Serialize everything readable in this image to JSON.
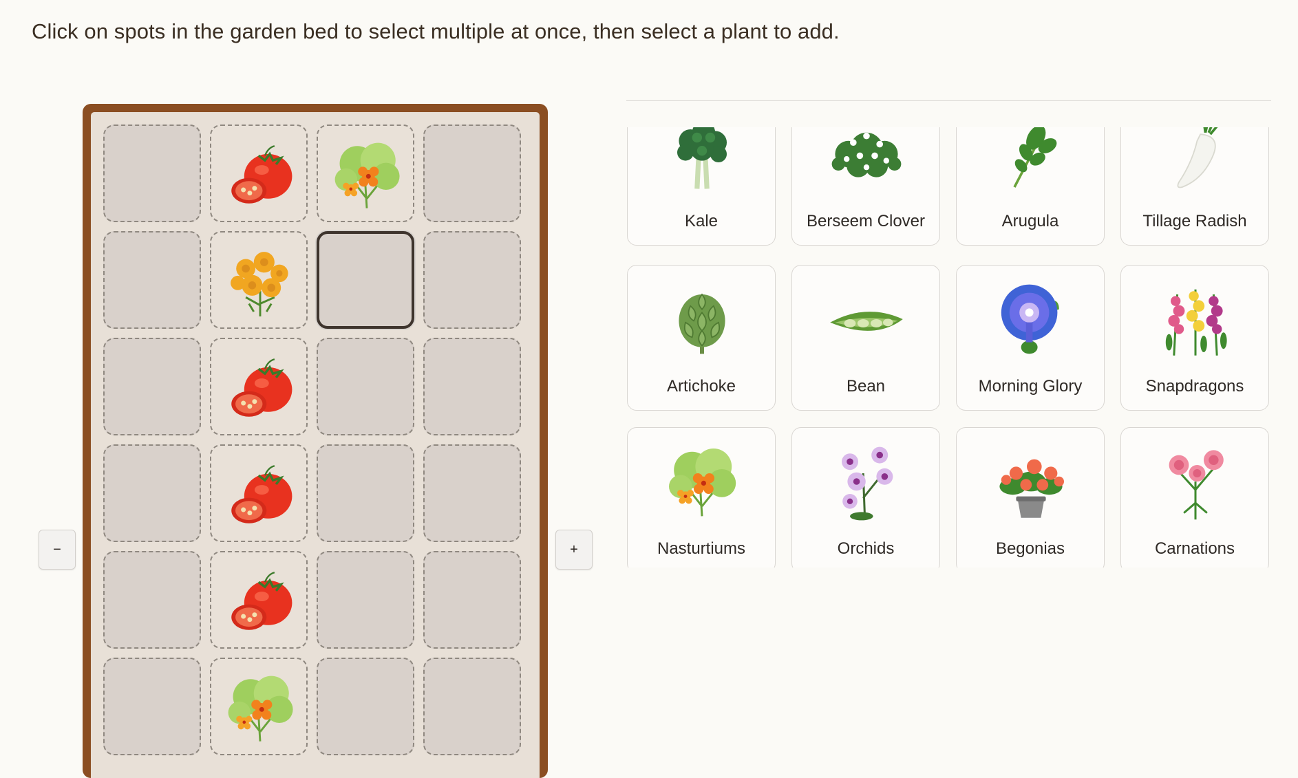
{
  "instructions": "Click on spots in the garden bed to select multiple at once, then select a plant to add.",
  "controls": {
    "decrease_label": "−",
    "increase_label": "+"
  },
  "garden_bed": {
    "columns": 4,
    "rows": [
      [
        "empty",
        "tomato",
        "nasturtium",
        "empty"
      ],
      [
        "empty",
        "marigold",
        "selected-empty",
        "empty"
      ],
      [
        "empty",
        "tomato",
        "empty",
        "empty"
      ],
      [
        "empty",
        "tomato",
        "empty",
        "empty"
      ],
      [
        "empty",
        "tomato",
        "empty",
        "empty"
      ],
      [
        "empty",
        "nasturtium",
        "empty",
        "empty"
      ]
    ]
  },
  "plants": [
    {
      "name": "Kale",
      "icon": "kale-icon"
    },
    {
      "name": "Berseem Clover",
      "icon": "clover-icon"
    },
    {
      "name": "Arugula",
      "icon": "arugula-icon"
    },
    {
      "name": "Tillage Radish",
      "icon": "radish-icon"
    },
    {
      "name": "Artichoke",
      "icon": "artichoke-icon"
    },
    {
      "name": "Bean",
      "icon": "bean-icon"
    },
    {
      "name": "Morning Glory",
      "icon": "morning-glory-icon"
    },
    {
      "name": "Snapdragons",
      "icon": "snapdragon-icon"
    },
    {
      "name": "Nasturtiums",
      "icon": "nasturtium-icon"
    },
    {
      "name": "Orchids",
      "icon": "orchid-icon"
    },
    {
      "name": "Begonias",
      "icon": "begonia-icon"
    },
    {
      "name": "Carnations",
      "icon": "carnation-icon"
    }
  ],
  "colors": {
    "bed_frame": "#8b4e22",
    "bed_soil": "#e8e0d7",
    "cell_empty": "#d9d1cb",
    "background": "#fbfaf6"
  }
}
